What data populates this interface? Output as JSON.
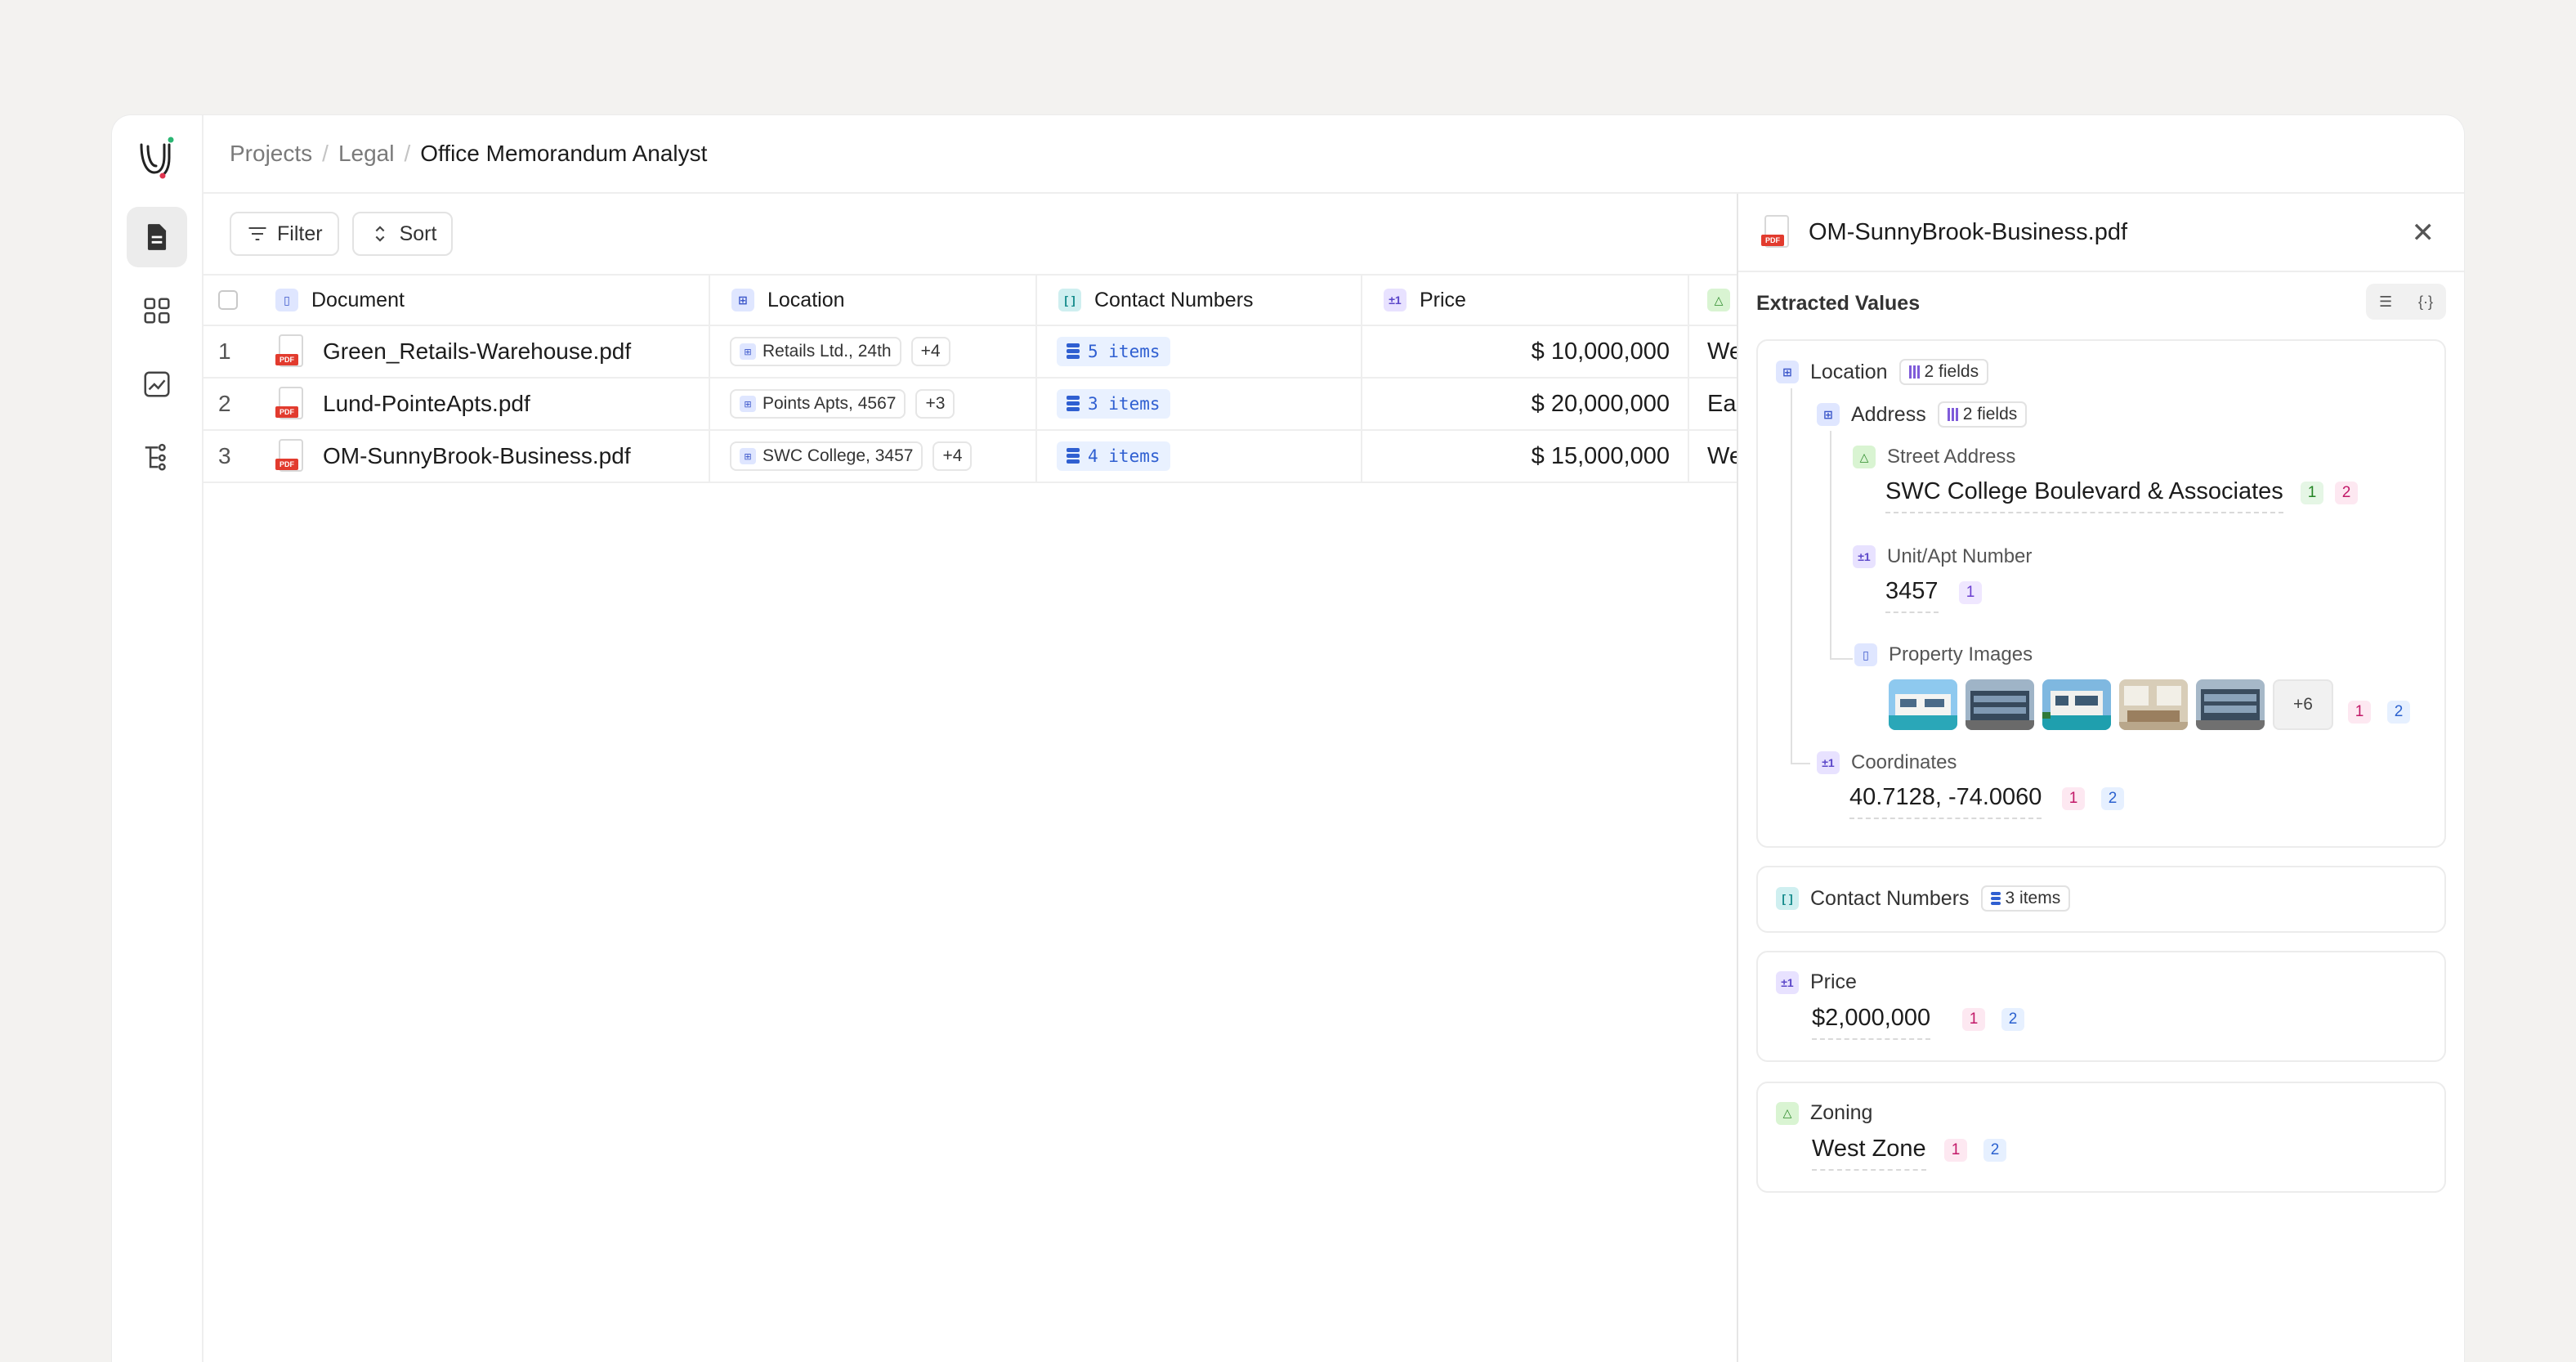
{
  "breadcrumb": {
    "items": [
      "Projects",
      "Legal"
    ],
    "current": "Office Memorandum Analyst"
  },
  "toolbar": {
    "filter_label": "Filter",
    "sort_label": "Sort"
  },
  "table": {
    "headers": {
      "document": "Document",
      "location": "Location",
      "contact": "Contact Numbers",
      "price": "Price"
    },
    "rows": [
      {
        "num": "1",
        "doc": "Green_Retails-Warehouse.pdf",
        "loc": "Retails Ltd., 24th",
        "loc_more": "+4",
        "contact": "5 items",
        "price": "$ 10,000,000",
        "zone": "We"
      },
      {
        "num": "2",
        "doc": "Lund-PointeApts.pdf",
        "loc": "Points Apts, 4567",
        "loc_more": "+3",
        "contact": "3 items",
        "price": "$ 20,000,000",
        "zone": "Eas"
      },
      {
        "num": "3",
        "doc": "OM-SunnyBrook-Business.pdf",
        "loc": "SWC College, 3457",
        "loc_more": "+4",
        "contact": "4 items",
        "price": "$ 15,000,000",
        "zone": "We"
      }
    ]
  },
  "panel": {
    "title": "OM-SunnyBrook-Business.pdf",
    "section_title": "Extracted Values",
    "location": {
      "label": "Location",
      "fields": "2 fields",
      "address": {
        "label": "Address",
        "fields": "2 fields"
      },
      "street": {
        "label": "Street Address",
        "value": "SWC College Boulevard & Associates",
        "refs": [
          "1",
          "2"
        ]
      },
      "unit": {
        "label": "Unit/Apt Number",
        "value": "3457",
        "refs": [
          "1"
        ]
      },
      "images": {
        "label": "Property Images",
        "more": "+6",
        "refs": [
          "1",
          "2"
        ]
      },
      "coords": {
        "label": "Coordinates",
        "value": "40.7128, -74.0060",
        "refs": [
          "1",
          "2"
        ]
      }
    },
    "contact": {
      "label": "Contact Numbers",
      "items": "3 items"
    },
    "price": {
      "label": "Price",
      "value": "$2,000,000",
      "refs": [
        "1",
        "2"
      ]
    },
    "zoning": {
      "label": "Zoning",
      "value": "West Zone",
      "refs": [
        "1",
        "2"
      ]
    }
  },
  "colors": {
    "accent": "#2f5fd1",
    "pink_ref": "#c21868",
    "green_ref": "#238423",
    "pdf_red": "#e23b2e"
  },
  "icons": {
    "rail": [
      "document-icon",
      "grid-icon",
      "chart-icon",
      "workflow-icon"
    ],
    "type_glyphs": {
      "bracket": "[ ]",
      "number": "±1",
      "zone": "△"
    }
  }
}
